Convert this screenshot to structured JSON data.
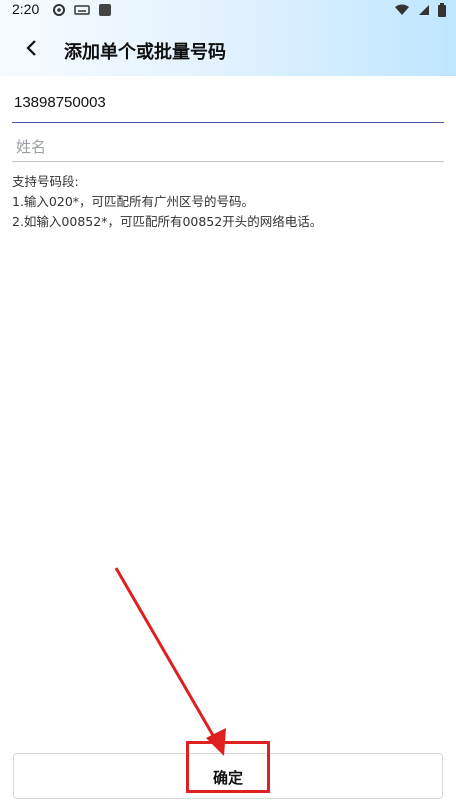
{
  "status_bar": {
    "time": "2:20",
    "left_icons": [
      "settings-icon",
      "keyboard-icon",
      "app-icon"
    ],
    "right_icons": [
      "wifi-icon",
      "signal-icon",
      "battery-icon"
    ]
  },
  "header": {
    "title": "添加单个或批量号码",
    "back_icon": "chevron-left-icon"
  },
  "form": {
    "phone_value": "13898750003",
    "name_placeholder": "姓名"
  },
  "help": {
    "title": "支持号码段:",
    "line1": "1.输入020*，可匹配所有广州区号的号码。",
    "line2": "2.如输入00852*，可匹配所有00852开头的网络电话。"
  },
  "footer": {
    "confirm_label": "确定"
  },
  "colors": {
    "annotation_red": "#e02020",
    "input_underline_active": "#4a55a2"
  }
}
